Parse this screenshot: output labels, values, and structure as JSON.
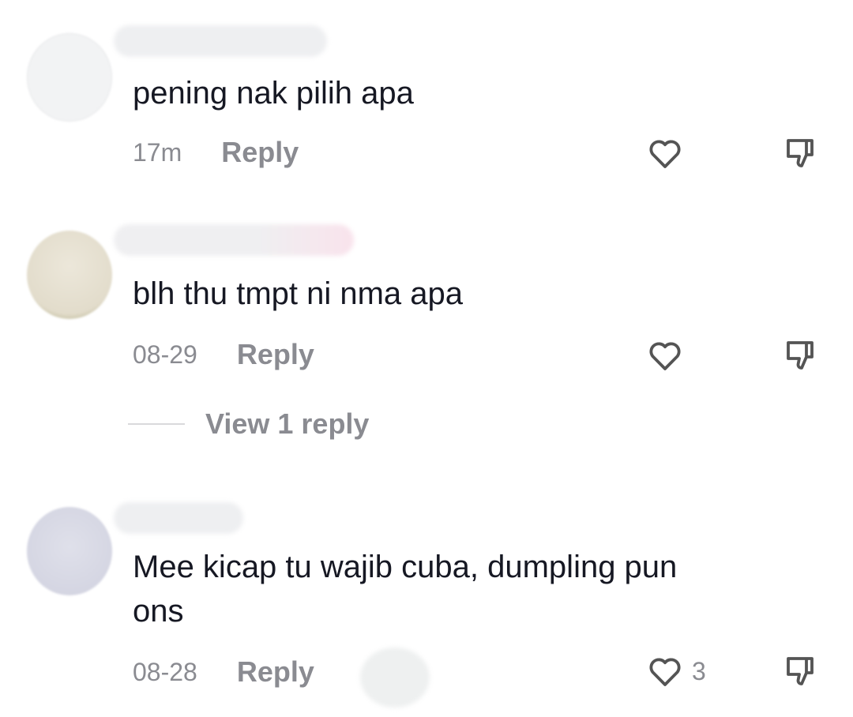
{
  "comments": [
    {
      "text": "pening nak pilih apa",
      "time": "17m",
      "reply_label": "Reply",
      "like_count": "",
      "avatar_color": "#f2f3f4",
      "name_blur_color": "#eeeff1"
    },
    {
      "text": "blh thu tmpt ni nma apa",
      "time": "08-29",
      "reply_label": "Reply",
      "like_count": "",
      "avatar_color": "#e7e2d4",
      "name_blur_color": "#efeff1",
      "view_replies_label": "View 1 reply"
    },
    {
      "text": "Mee kicap tu wajib cuba, dumpling pun\nons",
      "time": "08-28",
      "reply_label": "Reply",
      "like_count": "3",
      "avatar_color": "#d9dae6",
      "name_blur_color": "#eeeff1"
    }
  ],
  "icons": {
    "like": "heart-outline-icon",
    "dislike": "thumbs-down-outline-icon"
  },
  "colors": {
    "text": "#161823",
    "secondary": "#8a8b91",
    "icon": "#545454"
  }
}
